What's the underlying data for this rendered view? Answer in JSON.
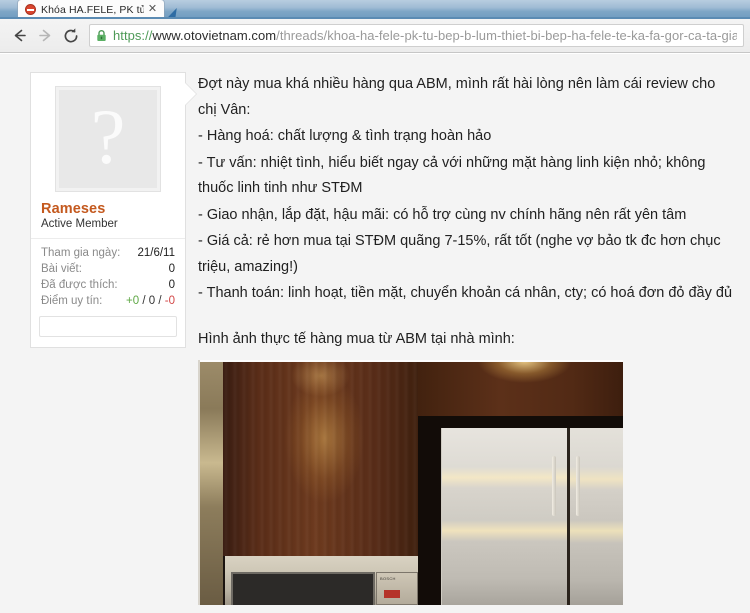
{
  "browser": {
    "tab": {
      "title": "Khóa HA.FELE, PK tủ bếp",
      "favicon": "forum-favicon",
      "close_label": "✕"
    },
    "nav": {
      "back_label": "Back",
      "forward_label": "Forward",
      "reload_label": "Reload"
    },
    "omnibox": {
      "scheme": "https://",
      "host": "www.otovietnam.com",
      "path": "/threads/khoa-ha-fele-pk-tu-bep-b-lum-thiet-bi-bep-ha-fele-te-ka-fa-gor-ca-ta-gia-to",
      "security": "secure-lock"
    }
  },
  "post": {
    "user": {
      "avatar_placeholder": "?",
      "name": "Rameses",
      "title": "Active Member",
      "stats": [
        {
          "label": "Tham gia ngày:",
          "value": "21/6/11"
        },
        {
          "label": "Bài viết:",
          "value": "0"
        },
        {
          "label": "Đã được thích:",
          "value": "0"
        }
      ],
      "reputation": {
        "label": "Điểm uy tín:",
        "positive": "+0",
        "neutral": "0",
        "negative": "-0",
        "separator": "/",
        "color_positive": "#5fa845",
        "color_neutral": "#333333",
        "color_negative": "#d24646"
      }
    },
    "body": {
      "paragraphs": [
        "Đợt này mua khá nhiều hàng qua ABM, mình rất hài lòng nên làm cái review cho chị Vân:",
        "- Hàng hoá: chất lượng & tình trạng hoàn hảo",
        "- Tư vấn: nhiệt tình, hiểu biết ngay cả với những mặt hàng linh kiện nhỏ; không thuốc linh tinh như STĐM",
        "- Giao nhận, lắp đặt, hậu mãi: có hỗ trợ cùng nv chính hãng nên rất yên tâm",
        "- Giá cả: rẻ hơn mua tại STĐM quãng 7-15%, rất tốt (nghe vợ bảo tk đc hơn chục triệu, amazing!)",
        "- Thanh toán: linh hoạt, tiền mặt, chuyển khoản cá nhân, cty; có hoá đơn đỏ đầy đủ"
      ],
      "image_caption": "Hình ảnh thực tế hàng mua từ ABM tại nhà mình:",
      "image_alt": "kitchen-photo-dark-wood-cabinets-stainless-refrigerator",
      "oven_brand": "BOSCH"
    }
  },
  "colors": {
    "username": "#c4591e",
    "body_text": "#212121",
    "page_background": "#f4f4f4",
    "panel_background": "#ffffff"
  }
}
